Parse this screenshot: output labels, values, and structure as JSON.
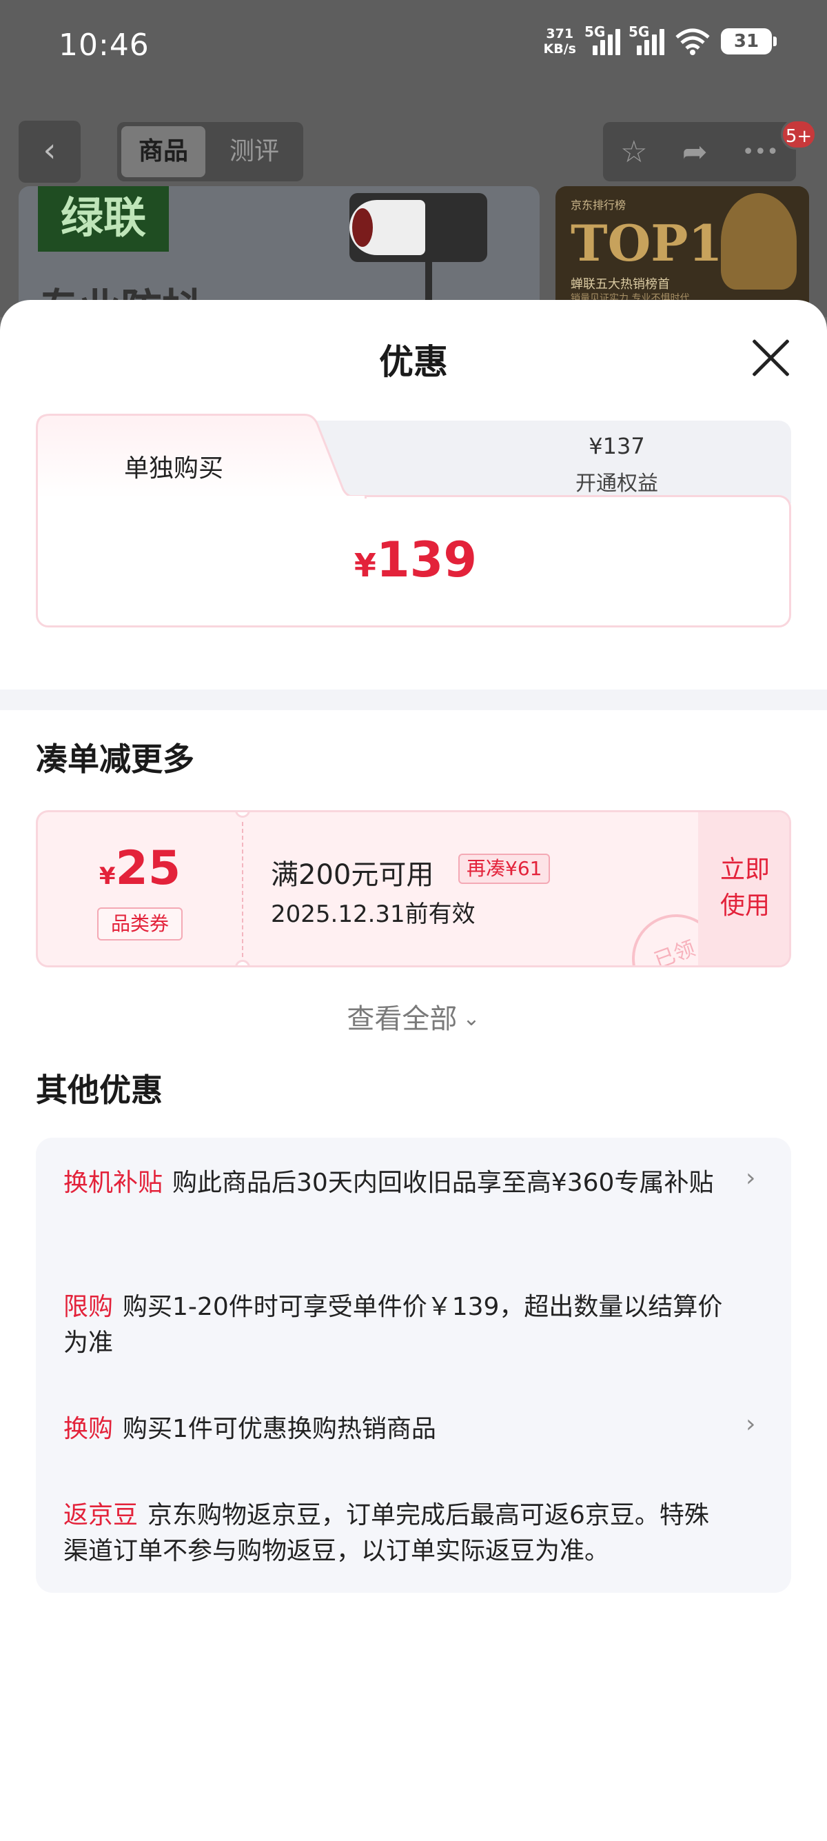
{
  "status_bar": {
    "time": "10:46",
    "net_speed_value": "371",
    "net_speed_unit": "KB/s",
    "signal1_label": "5G",
    "signal2_label": "5G",
    "wifi_level": "6",
    "battery": "31"
  },
  "nav": {
    "back_icon": "‹",
    "tabs": [
      {
        "label": "商品",
        "selected": true
      },
      {
        "label": "测评",
        "selected": false
      }
    ],
    "favorite_icon": "☆",
    "share_icon": "➦",
    "more_icon": "•••",
    "badge": "5+"
  },
  "background": {
    "brand_logo": "绿联",
    "banner_text": "专业防抖",
    "top1_sub": "京东排行榜",
    "top1_title": "TOP1",
    "top1_line": "蝉联五大热销榜首",
    "top1_line2": "销量见证实力 专业不惧时代"
  },
  "sheet": {
    "title": "优惠",
    "price_tabs": {
      "single_label": "单独购买",
      "member_price": "¥137",
      "member_label": "开通权益",
      "current_currency": "¥",
      "current_price": "139"
    },
    "section_coupons_title": "凑单减更多",
    "coupon": {
      "currency": "¥",
      "amount": "25",
      "type": "品类券",
      "condition": "满200元可用",
      "more_needed": "再凑¥61",
      "validity": "2025.12.31前有效",
      "action_line1": "立即",
      "action_line2": "使用",
      "stamp": "已领"
    },
    "view_all": "查看全部",
    "section_other_title": "其他优惠",
    "offers": [
      {
        "tag": "换机补贴",
        "text": "购此商品后30天内回收旧品享至高¥360专属补贴",
        "arrow": true
      },
      {
        "tag": "限购",
        "text": "购买1-20件时可享受单件价￥139，超出数量以结算价为准",
        "arrow": false
      },
      {
        "tag": "换购",
        "text": "购买1件可优惠换购热销商品",
        "arrow": true
      },
      {
        "tag": "返京豆",
        "text": "京东购物返京豆，订单完成后最高可返6京豆。特殊渠道订单不参与购物返豆，以订单实际返豆为准。",
        "arrow": false
      }
    ]
  },
  "colors": {
    "accent_red": "#e3223a",
    "coupon_bg": "#fff0f2",
    "panel_bg": "#f5f6fa"
  }
}
